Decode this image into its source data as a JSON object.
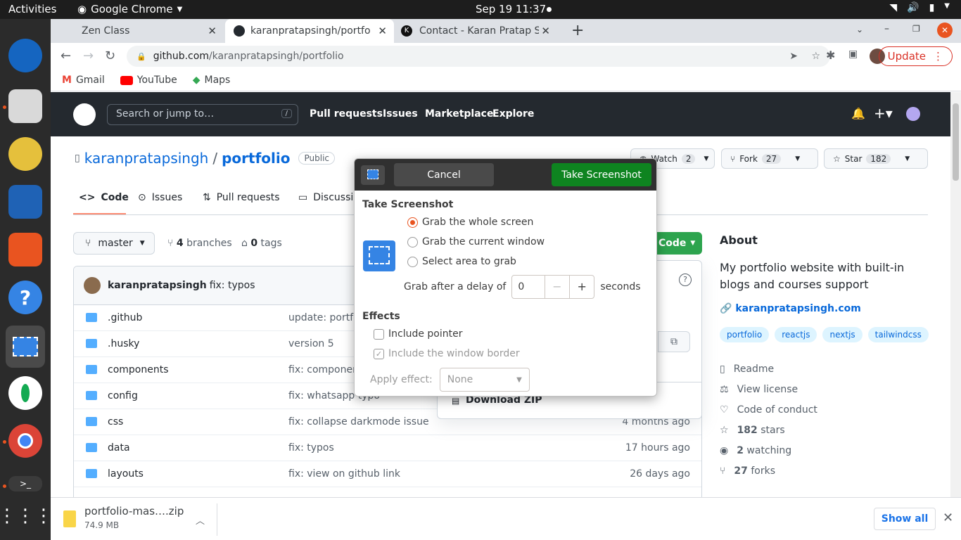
{
  "topbar": {
    "activities": "Activities",
    "app_name": "Google Chrome",
    "clock": "Sep 19  11:37"
  },
  "browser": {
    "tabs": [
      {
        "title": "Zen Class"
      },
      {
        "title": "karanpratapsingh/portfo"
      },
      {
        "title": "Contact - Karan Pratap Sin"
      }
    ],
    "url_host": "github.com",
    "url_path": "/karanpratapsingh/portfolio",
    "update_label": "Update",
    "bookmarks": [
      "Gmail",
      "YouTube",
      "Maps"
    ]
  },
  "github": {
    "search_placeholder": "Search or jump to…",
    "search_shortcut": "/",
    "nav": [
      "Pull requests",
      "Issues",
      "Marketplace",
      "Explore"
    ],
    "owner": "karanpratapsingh",
    "separator": "/",
    "repo": "portfolio",
    "visibility": "Public",
    "watch_label": "Watch",
    "watch_count": "2",
    "fork_label": "Fork",
    "fork_count": "27",
    "star_label": "Star",
    "star_count": "182",
    "tabs": [
      "Code",
      "Issues",
      "Pull requests",
      "Discussi"
    ],
    "branch": "master",
    "branches_count": "4",
    "branches_label": "branches",
    "tags_count": "0",
    "tags_label": "tags",
    "code_btn": "Code",
    "commit_author": "karanpratapsingh",
    "commit_message": "fix: typos",
    "files": [
      {
        "name": ".github",
        "message": "update: portfoli",
        "age": ""
      },
      {
        "name": ".husky",
        "message": "version 5",
        "age": ""
      },
      {
        "name": "components",
        "message": "fix: components",
        "age": ""
      },
      {
        "name": "config",
        "message": "fix: whatsapp typo",
        "age": ""
      },
      {
        "name": "css",
        "message": "fix: collapse darkmode issue",
        "age": "4 months ago"
      },
      {
        "name": "data",
        "message": "fix: typos",
        "age": "17 hours ago"
      },
      {
        "name": "layouts",
        "message": "fix: view on github link",
        "age": "26 days ago"
      }
    ],
    "download_zip": "Download ZIP",
    "about": {
      "heading": "About",
      "description": "My portfolio website with built-in blogs and courses support",
      "website": "karanpratapsingh.com",
      "topics": [
        "portfolio",
        "reactjs",
        "nextjs",
        "tailwindcss"
      ],
      "readme": "Readme",
      "license": "View license",
      "conduct": "Code of conduct",
      "stars_count": "182",
      "stars_label": "stars",
      "watching_count": "2",
      "watching_label": "watching",
      "forks_count": "27",
      "forks_label": "forks"
    }
  },
  "dialog": {
    "cancel": "Cancel",
    "take": "Take Screenshot",
    "heading": "Take Screenshot",
    "options": [
      "Grab the whole screen",
      "Grab the current window",
      "Select area to grab"
    ],
    "selected_option": 0,
    "delay_label": "Grab after a delay of",
    "delay_value": "0",
    "delay_minus": "−",
    "delay_plus": "+",
    "delay_unit": "seconds",
    "effects_heading": "Effects",
    "include_pointer": "Include pointer",
    "include_border": "Include the window border",
    "apply_label": "Apply effect:",
    "apply_value": "None"
  },
  "downloads": {
    "filename": "portfolio-mas….zip",
    "size": "74.9 MB",
    "show_all": "Show all"
  }
}
